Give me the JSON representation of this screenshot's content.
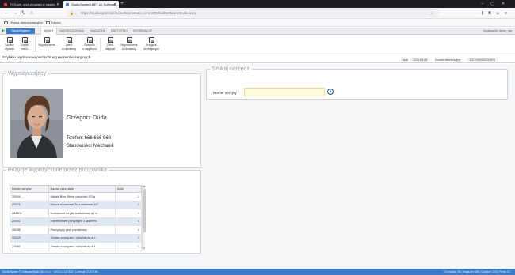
{
  "browser": {
    "tabs": [
      {
        "title": "TCS.net, czyli program w naszej...",
        "active": false
      },
      {
        "title": "StudioSystem.NET (c) Software...",
        "active": true
      }
    ],
    "new_tab": "+",
    "url": "https://studiosystemdemo.softwarestudio.com.pl/DefaultSoftwareStudio.aspx",
    "bookmarks": [
      "Wersja demonstracyjna",
      "Klienci"
    ]
  },
  "app": {
    "brand": "StudioSystem",
    "menu_tabs": [
      "NOWY",
      "NARZĘDZIOWNIA",
      "MAGAZYN",
      "KARTOTEKI",
      "INFORMACJE"
    ],
    "active_menu": "NARZĘDZIOWNIA",
    "user_info": "Użytkownik: demo_nar"
  },
  "ribbon": {
    "buttons": [
      {
        "label1": "Szybkie",
        "label2": "wydanie"
      },
      {
        "label1": "Szybki",
        "label2": "zwrot"
      },
      {
        "label1": "Wypożyczenie",
        "label2": ""
      },
      {
        "label1": "Zwrot",
        "label2": "do dostawcy"
      },
      {
        "label1": "Rozchód",
        "label2": "z magazynu"
      },
      {
        "label1": "Zwrot",
        "label2": "narzędzi"
      },
      {
        "label1": "Wypożyczenie",
        "label2": "od dostawcy"
      },
      {
        "label1": "Przyjęcie",
        "label2": "do magazynu"
      }
    ]
  },
  "page": {
    "title": "Szybkie wydawanie narzędzi wg numerów seryjnych",
    "date_label": "Data",
    "date_value": "2020-05-08",
    "ref_label": "Numer referencyjny",
    "ref_value": "6372446906331676"
  },
  "borrower": {
    "legend": "Wypożyczający",
    "name": "Grzegorz Duda",
    "phone": "Telefon: 666 666 666",
    "position": "Stanowisko: Mechanik"
  },
  "search": {
    "legend": "Szukaj narzędzi",
    "serial_label": "Numer seryjny",
    "serial_value": "",
    "info_icon": "i"
  },
  "items": {
    "legend": "Pozycje wypożyczone przez pracownika",
    "columns": [
      "Numer seryjny",
      "Nazwa narzędzia",
      "Ilość"
    ],
    "rows": [
      [
        "20394",
        "Młotek Blue Strike ciesielski 570g",
        "1"
      ],
      [
        "20021",
        "Klucze nasadowe Torx udarowe 1/2\"",
        "2"
      ],
      [
        "884304",
        "Brzeszczot do piły kabłąkowej do d...",
        "3"
      ],
      [
        "20092",
        "Interferometr precyzyjny z laserem",
        "4"
      ],
      [
        "20036",
        "Precyzyjny pion pomiarowy",
        "6"
      ],
      [
        "20928",
        "Zestaw szczypiec i wkrętaków w r...",
        "2"
      ],
      [
        "21086",
        "Zestaw szczypiec i wkrętaków w r...",
        "1"
      ]
    ]
  },
  "footer": {
    "left": "StudioSystem © SoftwareStudio Sp. z o.o. · v2020.4.12.1823 · Licencja: CUSTOM",
    "right": "1 Kontrolka: 89 | Magazyn: MM | Oddział: CEN | Firma: 01"
  },
  "colors": {
    "accent": "#3b7bc8",
    "input_highlight": "#fffbdc",
    "row_alt": "#dfe8f3",
    "start_green": "#2a9d3a"
  },
  "icons": [
    "back-icon",
    "forward-icon",
    "reload-icon",
    "home-icon",
    "lock-icon",
    "info-icon",
    "play-icon"
  ]
}
